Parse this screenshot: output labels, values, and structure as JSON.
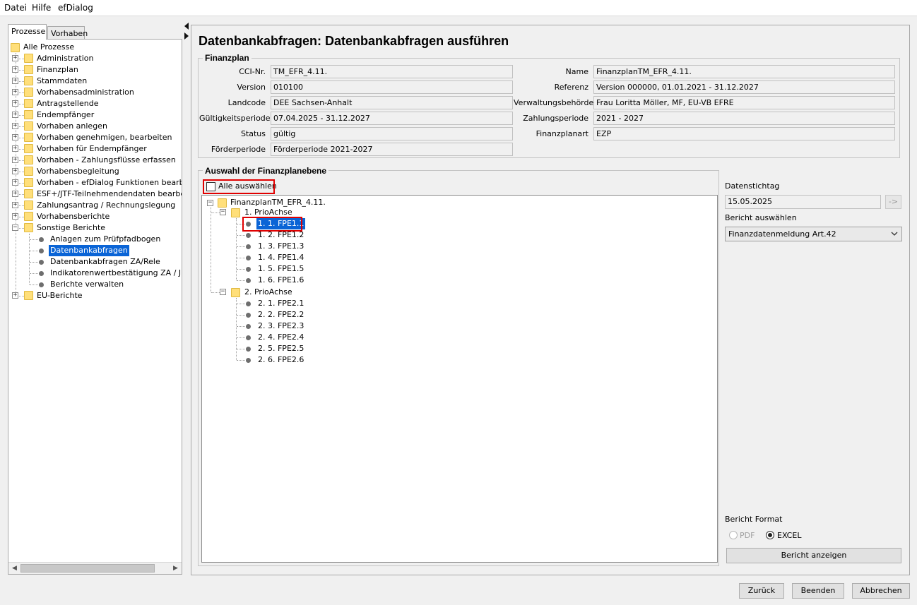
{
  "menu": [
    "Datei",
    "Hilfe",
    "efDialog"
  ],
  "tabs": [
    "Prozesse",
    "Vorhaben"
  ],
  "process_tree": {
    "root": "Alle Prozesse",
    "items": [
      "Administration",
      "Finanzplan",
      "Stammdaten",
      "Vorhabensadministration",
      "Antragstellende",
      "Endempfänger",
      "Vorhaben anlegen",
      "Vorhaben genehmigen, bearbeiten",
      "Vorhaben für Endempfänger",
      "Vorhaben - Zahlungsflüsse erfassen",
      "Vorhabensbegleitung",
      "Vorhaben - efDialog Funktionen bearbeiten",
      "ESF+/JTF-Teilnehmendendaten bearbeiten",
      "Zahlungsantrag / Rechnungslegung",
      "Vorhabensberichte",
      "Sonstige Berichte"
    ],
    "sub_items": [
      "Anlagen zum Prüfpfadbogen",
      "Datenbankabfragen",
      "Datenbankabfragen ZA/Rele",
      "Indikatorenwertbestätigung ZA / JDB",
      "Berichte verwalten"
    ],
    "last_item": "EU-Berichte"
  },
  "page_title": "Datenbankabfragen: Datenbankabfragen ausführen",
  "finanzplan": {
    "title": "Finanzplan",
    "left": [
      {
        "label": "CCI-Nr.",
        "value": "TM_EFR_4.11."
      },
      {
        "label": "Version",
        "value": "010100"
      },
      {
        "label": "Landcode",
        "value": "DEE Sachsen-Anhalt"
      },
      {
        "label": "Gültigkeitsperiode",
        "value": "07.04.2025 - 31.12.2027"
      },
      {
        "label": "Status",
        "value": "gültig"
      },
      {
        "label": "Förderperiode",
        "value": "Förderperiode 2021-2027"
      }
    ],
    "right": [
      {
        "label": "Name",
        "value": "FinanzplanTM_EFR_4.11."
      },
      {
        "label": "Referenz",
        "value": "Version 000000,  01.01.2021 - 31.12.2027"
      },
      {
        "label": "Verwaltungsbehörde",
        "value": "Frau Loritta Möller,  MF, EU-VB EFRE"
      },
      {
        "label": "Zahlungsperiode",
        "value": "2021 - 2027"
      },
      {
        "label": "Finanzplanart",
        "value": "EZP"
      }
    ]
  },
  "auswahl": {
    "title": "Auswahl der Finanzplanebene",
    "select_all": "Alle auswählen",
    "root": "FinanzplanTM_EFR_4.11.",
    "achse1": "1. PrioAchse",
    "achse1_items": [
      "1. 1. FPE1.1",
      "1. 2. FPE1.2",
      "1. 3. FPE1.3",
      "1. 4. FPE1.4",
      "1. 5. FPE1.5",
      "1. 6. FPE1.6"
    ],
    "achse2": "2. PrioAchse",
    "achse2_items": [
      "2. 1. FPE2.1",
      "2. 2. FPE2.2",
      "2. 3. FPE2.3",
      "2. 4. FPE2.4",
      "2. 5. FPE2.5",
      "2. 6. FPE2.6"
    ]
  },
  "side": {
    "datenstichtag_label": "Datenstichtag",
    "datenstichtag_value": "15.05.2025",
    "go_button": "->",
    "bericht_label": "Bericht auswählen",
    "bericht_value": "Finanzdatenmeldung Art.42",
    "format_label": "Bericht Format",
    "format_pdf": "PDF",
    "format_excel": "EXCEL",
    "format_selected": "EXCEL",
    "show_button": "Bericht anzeigen"
  },
  "footer": {
    "back": "Zurück",
    "end": "Beenden",
    "cancel": "Abbrechen"
  },
  "colors": {
    "selection": "#0a64d6",
    "highlight": "#e00000",
    "folder": "#ffdf7a"
  }
}
